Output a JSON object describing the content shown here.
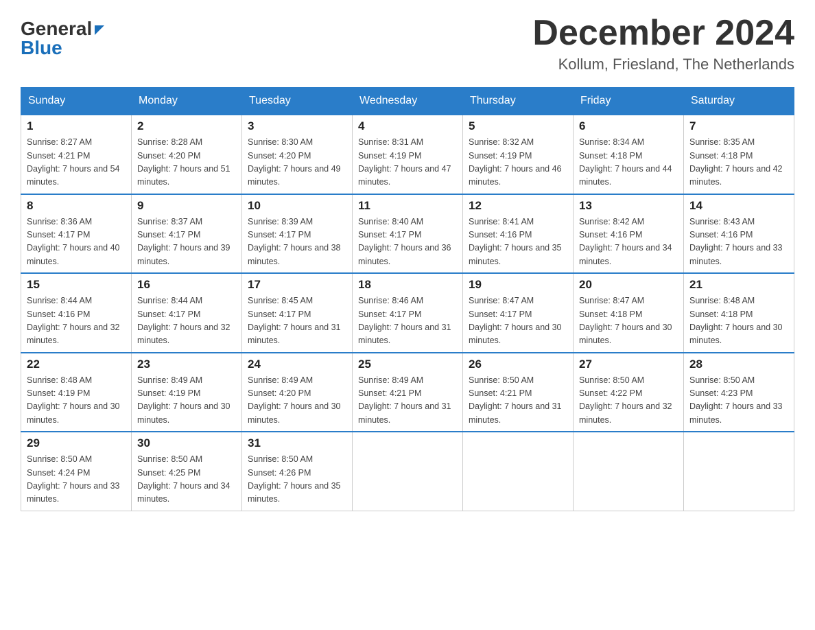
{
  "header": {
    "logo_general": "General",
    "logo_blue": "Blue",
    "month_title": "December 2024",
    "location": "Kollum, Friesland, The Netherlands"
  },
  "weekdays": [
    "Sunday",
    "Monday",
    "Tuesday",
    "Wednesday",
    "Thursday",
    "Friday",
    "Saturday"
  ],
  "weeks": [
    [
      {
        "day": "1",
        "sunrise": "8:27 AM",
        "sunset": "4:21 PM",
        "daylight": "7 hours and 54 minutes."
      },
      {
        "day": "2",
        "sunrise": "8:28 AM",
        "sunset": "4:20 PM",
        "daylight": "7 hours and 51 minutes."
      },
      {
        "day": "3",
        "sunrise": "8:30 AM",
        "sunset": "4:20 PM",
        "daylight": "7 hours and 49 minutes."
      },
      {
        "day": "4",
        "sunrise": "8:31 AM",
        "sunset": "4:19 PM",
        "daylight": "7 hours and 47 minutes."
      },
      {
        "day": "5",
        "sunrise": "8:32 AM",
        "sunset": "4:19 PM",
        "daylight": "7 hours and 46 minutes."
      },
      {
        "day": "6",
        "sunrise": "8:34 AM",
        "sunset": "4:18 PM",
        "daylight": "7 hours and 44 minutes."
      },
      {
        "day": "7",
        "sunrise": "8:35 AM",
        "sunset": "4:18 PM",
        "daylight": "7 hours and 42 minutes."
      }
    ],
    [
      {
        "day": "8",
        "sunrise": "8:36 AM",
        "sunset": "4:17 PM",
        "daylight": "7 hours and 40 minutes."
      },
      {
        "day": "9",
        "sunrise": "8:37 AM",
        "sunset": "4:17 PM",
        "daylight": "7 hours and 39 minutes."
      },
      {
        "day": "10",
        "sunrise": "8:39 AM",
        "sunset": "4:17 PM",
        "daylight": "7 hours and 38 minutes."
      },
      {
        "day": "11",
        "sunrise": "8:40 AM",
        "sunset": "4:17 PM",
        "daylight": "7 hours and 36 minutes."
      },
      {
        "day": "12",
        "sunrise": "8:41 AM",
        "sunset": "4:16 PM",
        "daylight": "7 hours and 35 minutes."
      },
      {
        "day": "13",
        "sunrise": "8:42 AM",
        "sunset": "4:16 PM",
        "daylight": "7 hours and 34 minutes."
      },
      {
        "day": "14",
        "sunrise": "8:43 AM",
        "sunset": "4:16 PM",
        "daylight": "7 hours and 33 minutes."
      }
    ],
    [
      {
        "day": "15",
        "sunrise": "8:44 AM",
        "sunset": "4:16 PM",
        "daylight": "7 hours and 32 minutes."
      },
      {
        "day": "16",
        "sunrise": "8:44 AM",
        "sunset": "4:17 PM",
        "daylight": "7 hours and 32 minutes."
      },
      {
        "day": "17",
        "sunrise": "8:45 AM",
        "sunset": "4:17 PM",
        "daylight": "7 hours and 31 minutes."
      },
      {
        "day": "18",
        "sunrise": "8:46 AM",
        "sunset": "4:17 PM",
        "daylight": "7 hours and 31 minutes."
      },
      {
        "day": "19",
        "sunrise": "8:47 AM",
        "sunset": "4:17 PM",
        "daylight": "7 hours and 30 minutes."
      },
      {
        "day": "20",
        "sunrise": "8:47 AM",
        "sunset": "4:18 PM",
        "daylight": "7 hours and 30 minutes."
      },
      {
        "day": "21",
        "sunrise": "8:48 AM",
        "sunset": "4:18 PM",
        "daylight": "7 hours and 30 minutes."
      }
    ],
    [
      {
        "day": "22",
        "sunrise": "8:48 AM",
        "sunset": "4:19 PM",
        "daylight": "7 hours and 30 minutes."
      },
      {
        "day": "23",
        "sunrise": "8:49 AM",
        "sunset": "4:19 PM",
        "daylight": "7 hours and 30 minutes."
      },
      {
        "day": "24",
        "sunrise": "8:49 AM",
        "sunset": "4:20 PM",
        "daylight": "7 hours and 30 minutes."
      },
      {
        "day": "25",
        "sunrise": "8:49 AM",
        "sunset": "4:21 PM",
        "daylight": "7 hours and 31 minutes."
      },
      {
        "day": "26",
        "sunrise": "8:50 AM",
        "sunset": "4:21 PM",
        "daylight": "7 hours and 31 minutes."
      },
      {
        "day": "27",
        "sunrise": "8:50 AM",
        "sunset": "4:22 PM",
        "daylight": "7 hours and 32 minutes."
      },
      {
        "day": "28",
        "sunrise": "8:50 AM",
        "sunset": "4:23 PM",
        "daylight": "7 hours and 33 minutes."
      }
    ],
    [
      {
        "day": "29",
        "sunrise": "8:50 AM",
        "sunset": "4:24 PM",
        "daylight": "7 hours and 33 minutes."
      },
      {
        "day": "30",
        "sunrise": "8:50 AM",
        "sunset": "4:25 PM",
        "daylight": "7 hours and 34 minutes."
      },
      {
        "day": "31",
        "sunrise": "8:50 AM",
        "sunset": "4:26 PM",
        "daylight": "7 hours and 35 minutes."
      },
      null,
      null,
      null,
      null
    ]
  ]
}
